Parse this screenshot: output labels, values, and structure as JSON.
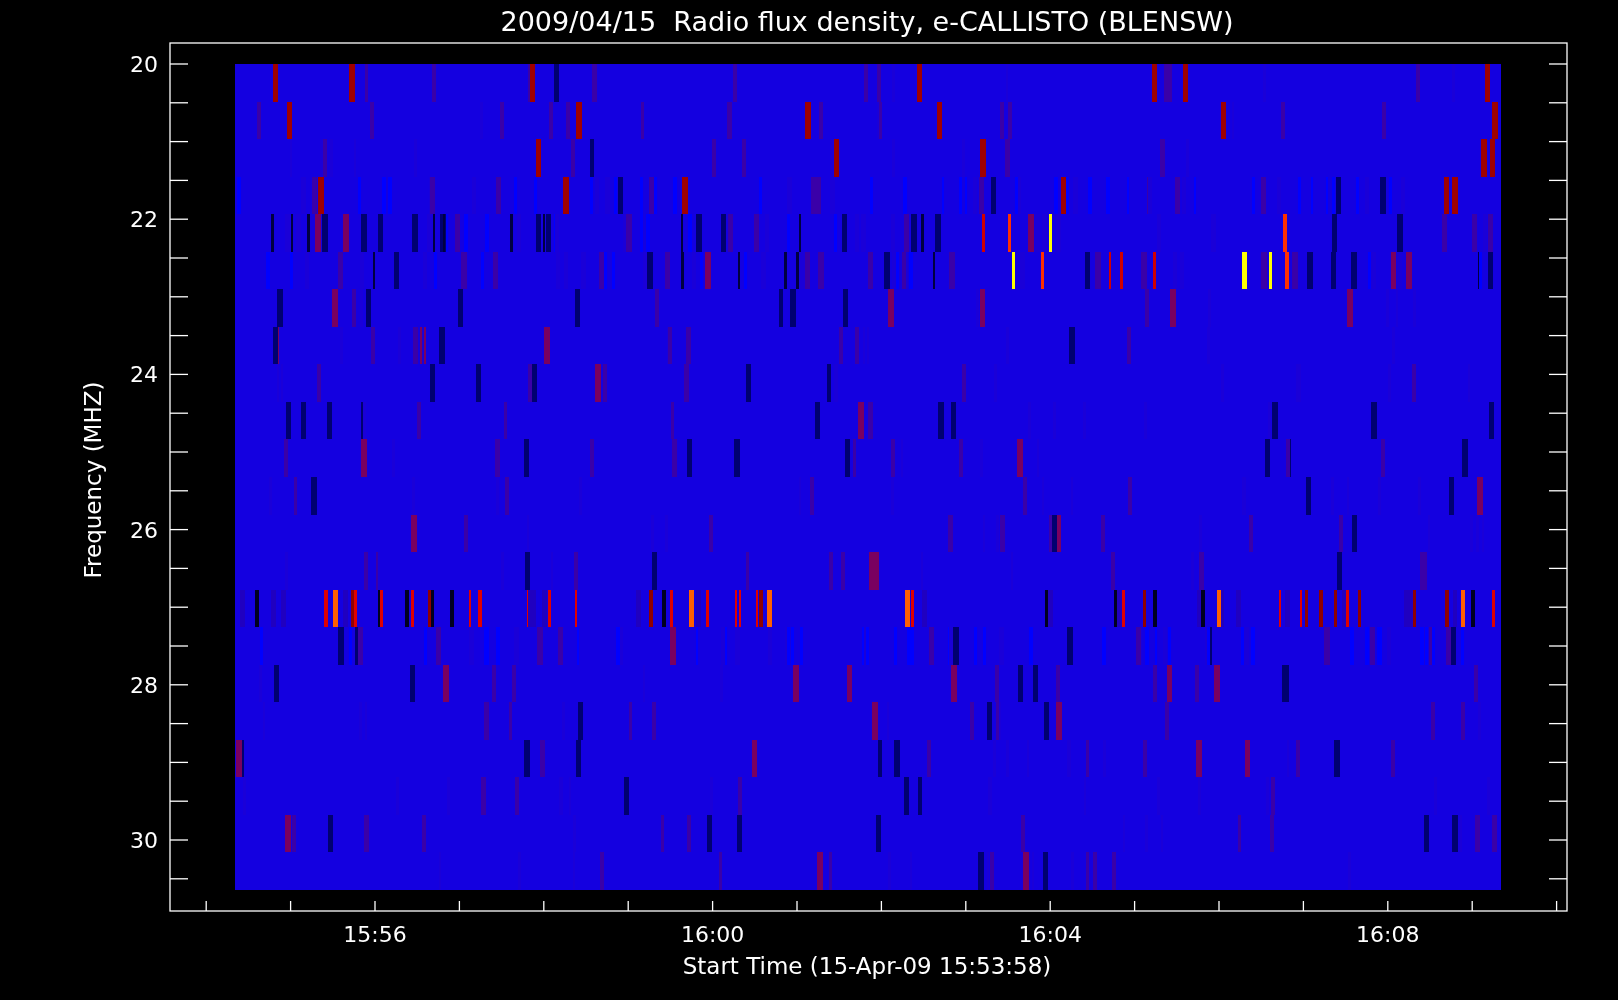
{
  "plot": {
    "title": "2009/04/15  Radio flux density, e-CALLISTO (BLENSW)",
    "xlabel": "Start Time (15-Apr-09 15:53:58)",
    "ylabel": "Frequency (MHZ)",
    "xticks": [
      "15:56",
      "16:00",
      "16:04",
      "16:08"
    ],
    "yticks": [
      "20",
      "22",
      "24",
      "26",
      "28",
      "30"
    ]
  }
}
